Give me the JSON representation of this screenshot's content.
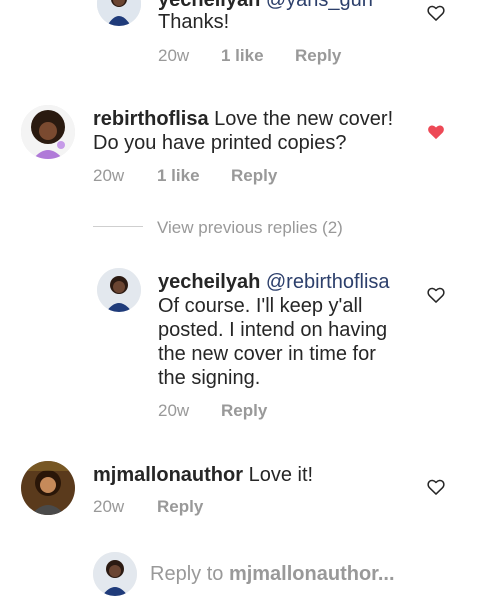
{
  "comments": [
    {
      "username": "yecheilyah",
      "mention": "@yahs_gurl",
      "text": "Thanks!",
      "time": "20w",
      "likes": "1 like",
      "reply": "Reply"
    },
    {
      "username": "rebirthoflisa",
      "text_line1": "Love the new cover!",
      "text_line2": "Do you have printed copies?",
      "time": "20w",
      "likes": "1 like",
      "reply": "Reply"
    },
    {
      "username": "yecheilyah",
      "mention": "@rebirthoflisa",
      "lines": [
        "Of course. I'll keep y'all",
        "posted. I intend on having",
        "the new cover in time for",
        "the signing."
      ],
      "time": "20w",
      "reply": "Reply"
    },
    {
      "username": "mjmallonauthor",
      "text": "Love it!",
      "time": "20w",
      "reply": "Reply"
    }
  ],
  "view_previous": "View previous replies (2)",
  "reply_input": {
    "placeholder_prefix": "Reply to ",
    "placeholder_user": "mjmallonauthor..."
  },
  "colors": {
    "liked_heart": "#ed4956",
    "meta": "#999999",
    "mention": "#2c3f6b"
  }
}
